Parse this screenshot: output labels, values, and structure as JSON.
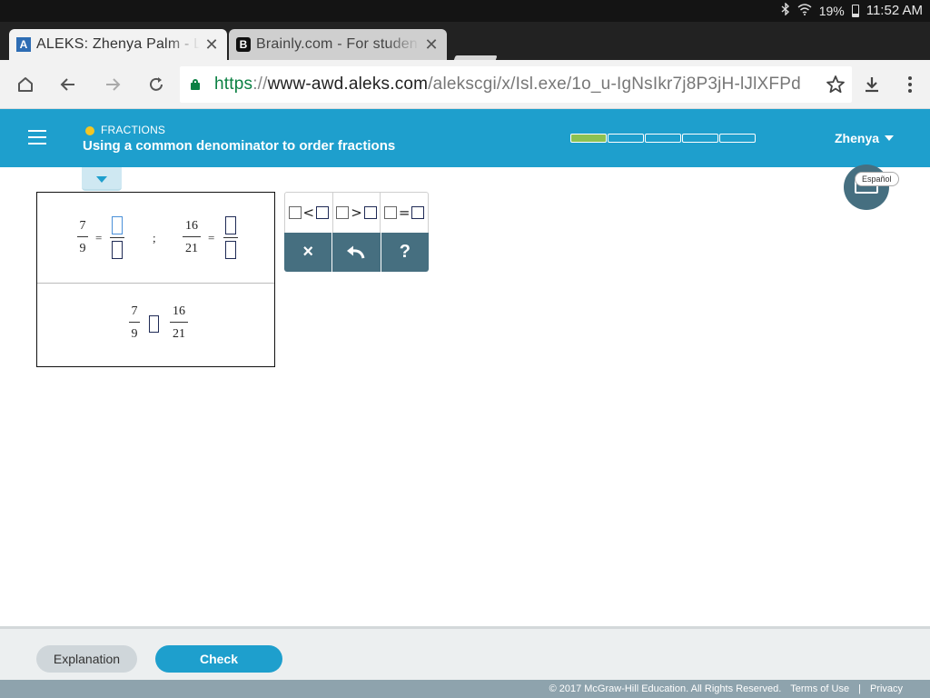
{
  "status_bar": {
    "battery": "19%",
    "time": "11:52 AM",
    "icons": [
      "bluetooth-icon",
      "wifi-icon",
      "battery-icon"
    ]
  },
  "tabs": [
    {
      "title": "ALEKS: Zhenya Palm - L",
      "favicon": "A",
      "active": true
    },
    {
      "title": "Brainly.com - For studen",
      "favicon": "B",
      "active": false
    }
  ],
  "toolbar": {
    "url_scheme": "https",
    "url_sep": "://",
    "url_host": "www-awd.aleks.com",
    "url_path": "/alekscgi/x/Isl.exe/1o_u-IgNsIkr7j8P3jH-lJlXFPd"
  },
  "header": {
    "topic_category": "FRACTIONS",
    "topic_title": "Using a common denominator to order fractions",
    "progress": {
      "segments": 5,
      "completed": 1
    },
    "user_name": "Zhenya",
    "language_button": "Español"
  },
  "problem": {
    "fraction1": {
      "numerator": "7",
      "denominator": "9"
    },
    "fraction2": {
      "numerator": "16",
      "denominator": "21"
    },
    "equals": "=",
    "separator": ";"
  },
  "palette": {
    "less_than": "<",
    "greater_than": ">",
    "equal": "=",
    "clear": "×",
    "help": "?"
  },
  "buttons": {
    "explanation": "Explanation",
    "check": "Check"
  },
  "footer": {
    "copyright": "© 2017 McGraw-Hill Education. All Rights Reserved.",
    "terms": "Terms of Use",
    "divider": "|",
    "privacy": "Privacy"
  },
  "colors": {
    "aleks_blue": "#1e9fcd",
    "slate": "#466f80",
    "progress_green": "#8cc152",
    "topic_yellow": "#f3c623"
  }
}
